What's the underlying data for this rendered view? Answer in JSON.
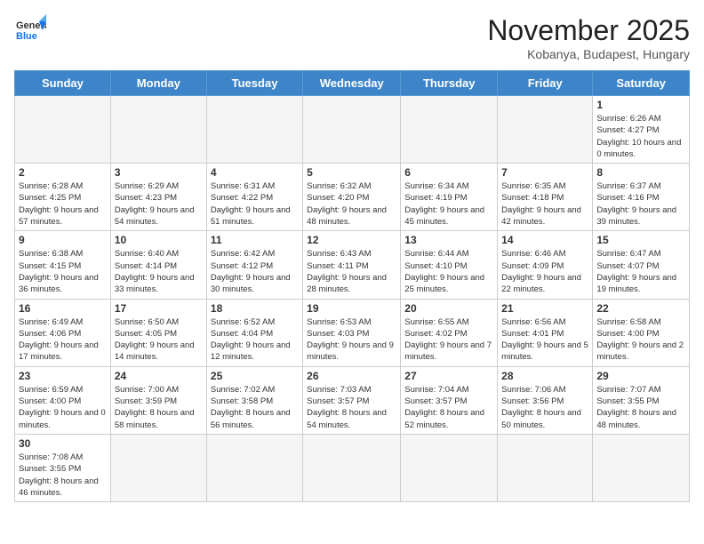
{
  "header": {
    "logo_general": "General",
    "logo_blue": "Blue",
    "month": "November 2025",
    "location": "Kobanya, Budapest, Hungary"
  },
  "weekdays": [
    "Sunday",
    "Monday",
    "Tuesday",
    "Wednesday",
    "Thursday",
    "Friday",
    "Saturday"
  ],
  "days": {
    "1": "Sunrise: 6:26 AM\nSunset: 4:27 PM\nDaylight: 10 hours and 0 minutes.",
    "2": "Sunrise: 6:28 AM\nSunset: 4:25 PM\nDaylight: 9 hours and 57 minutes.",
    "3": "Sunrise: 6:29 AM\nSunset: 4:23 PM\nDaylight: 9 hours and 54 minutes.",
    "4": "Sunrise: 6:31 AM\nSunset: 4:22 PM\nDaylight: 9 hours and 51 minutes.",
    "5": "Sunrise: 6:32 AM\nSunset: 4:20 PM\nDaylight: 9 hours and 48 minutes.",
    "6": "Sunrise: 6:34 AM\nSunset: 4:19 PM\nDaylight: 9 hours and 45 minutes.",
    "7": "Sunrise: 6:35 AM\nSunset: 4:18 PM\nDaylight: 9 hours and 42 minutes.",
    "8": "Sunrise: 6:37 AM\nSunset: 4:16 PM\nDaylight: 9 hours and 39 minutes.",
    "9": "Sunrise: 6:38 AM\nSunset: 4:15 PM\nDaylight: 9 hours and 36 minutes.",
    "10": "Sunrise: 6:40 AM\nSunset: 4:14 PM\nDaylight: 9 hours and 33 minutes.",
    "11": "Sunrise: 6:42 AM\nSunset: 4:12 PM\nDaylight: 9 hours and 30 minutes.",
    "12": "Sunrise: 6:43 AM\nSunset: 4:11 PM\nDaylight: 9 hours and 28 minutes.",
    "13": "Sunrise: 6:44 AM\nSunset: 4:10 PM\nDaylight: 9 hours and 25 minutes.",
    "14": "Sunrise: 6:46 AM\nSunset: 4:09 PM\nDaylight: 9 hours and 22 minutes.",
    "15": "Sunrise: 6:47 AM\nSunset: 4:07 PM\nDaylight: 9 hours and 19 minutes.",
    "16": "Sunrise: 6:49 AM\nSunset: 4:06 PM\nDaylight: 9 hours and 17 minutes.",
    "17": "Sunrise: 6:50 AM\nSunset: 4:05 PM\nDaylight: 9 hours and 14 minutes.",
    "18": "Sunrise: 6:52 AM\nSunset: 4:04 PM\nDaylight: 9 hours and 12 minutes.",
    "19": "Sunrise: 6:53 AM\nSunset: 4:03 PM\nDaylight: 9 hours and 9 minutes.",
    "20": "Sunrise: 6:55 AM\nSunset: 4:02 PM\nDaylight: 9 hours and 7 minutes.",
    "21": "Sunrise: 6:56 AM\nSunset: 4:01 PM\nDaylight: 9 hours and 5 minutes.",
    "22": "Sunrise: 6:58 AM\nSunset: 4:00 PM\nDaylight: 9 hours and 2 minutes.",
    "23": "Sunrise: 6:59 AM\nSunset: 4:00 PM\nDaylight: 9 hours and 0 minutes.",
    "24": "Sunrise: 7:00 AM\nSunset: 3:59 PM\nDaylight: 8 hours and 58 minutes.",
    "25": "Sunrise: 7:02 AM\nSunset: 3:58 PM\nDaylight: 8 hours and 56 minutes.",
    "26": "Sunrise: 7:03 AM\nSunset: 3:57 PM\nDaylight: 8 hours and 54 minutes.",
    "27": "Sunrise: 7:04 AM\nSunset: 3:57 PM\nDaylight: 8 hours and 52 minutes.",
    "28": "Sunrise: 7:06 AM\nSunset: 3:56 PM\nDaylight: 8 hours and 50 minutes.",
    "29": "Sunrise: 7:07 AM\nSunset: 3:55 PM\nDaylight: 8 hours and 48 minutes.",
    "30": "Sunrise: 7:08 AM\nSunset: 3:55 PM\nDaylight: 8 hours and 46 minutes."
  }
}
